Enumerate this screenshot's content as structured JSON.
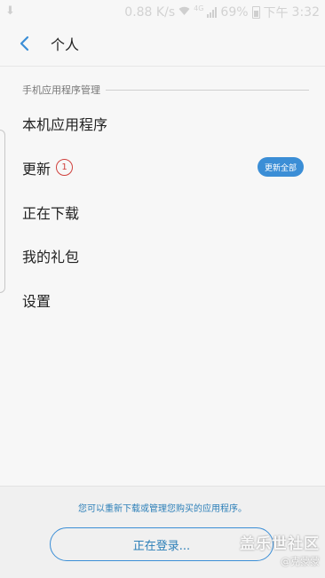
{
  "status_bar": {
    "speed": "0.88 K/s",
    "network_type": "4G",
    "battery": "69%",
    "time_period": "下午",
    "time": "3:32"
  },
  "header": {
    "back_icon": "chevron-left-icon",
    "title": "个人"
  },
  "section": {
    "title": "手机应用程序管理"
  },
  "menu": {
    "items": [
      {
        "label": "本机应用程序"
      },
      {
        "label": "更新",
        "badge": "1",
        "action": "更新全部"
      },
      {
        "label": "正在下载"
      },
      {
        "label": "我的礼包"
      },
      {
        "label": "设置"
      }
    ]
  },
  "footer": {
    "hint": "您可以重新下载或管理您购买的应用程序。",
    "login_button": "正在登录..."
  },
  "watermark": {
    "brand": "盖乐世社区",
    "author": "@克蒙蒙"
  },
  "colors": {
    "accent": "#3b8ed6",
    "badge": "#d0413d",
    "background": "#f7f7f7"
  }
}
